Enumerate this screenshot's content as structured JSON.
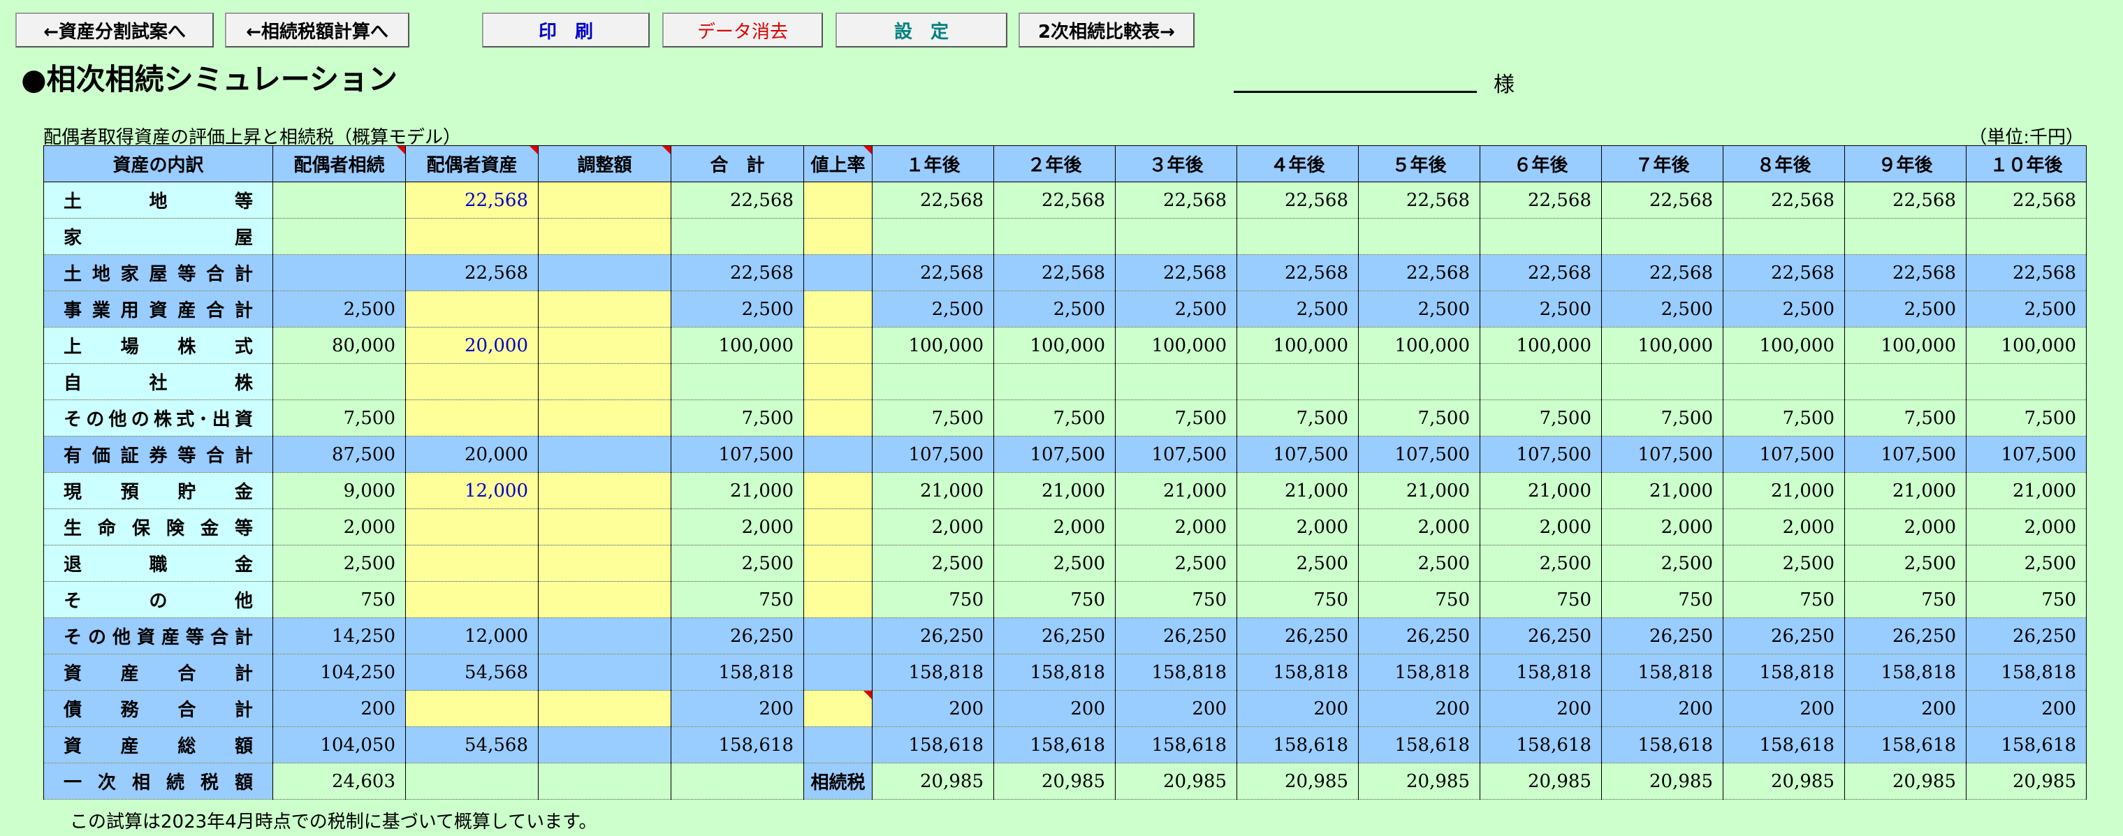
{
  "toolbar": {
    "buttons": [
      {
        "label": "←資産分割試案へ"
      },
      {
        "label": "←相続税額計算へ"
      },
      {
        "label": "印　刷"
      },
      {
        "label": "データ消去"
      },
      {
        "label": "設　定"
      },
      {
        "label": "2次相続比較表→"
      }
    ]
  },
  "colors": {
    "background": "#ccffcc",
    "header": "#99ccff",
    "input": "#ffff99",
    "detail_label": "#ccffff",
    "print_text": "#0000cc",
    "clear_text": "#e00000",
    "settings_text": "#008080"
  },
  "page": {
    "title": "●相次相続シミュレーション",
    "name_suffix": "様",
    "subtitle": "配偶者取得資産の評価上昇と相続税（概算モデル）",
    "unit": "（単位:千円）",
    "footnote": "この試算は2023年4月時点での税制に基づいて概算しています。"
  },
  "table": {
    "headers": [
      "資産の内訳",
      "配偶者相続",
      "配偶者資産",
      "調整額",
      "合　計",
      "値上率",
      "１年後",
      "２年後",
      "３年後",
      "４年後",
      "５年後",
      "６年後",
      "７年後",
      "８年後",
      "９年後",
      "１０年後"
    ],
    "rows": [
      {
        "label": "土地等",
        "type": "detail",
        "cells": [
          "",
          "22,568",
          "",
          "22,568",
          "",
          "22,568",
          "22,568",
          "22,568",
          "22,568",
          "22,568",
          "22,568",
          "22,568",
          "22,568",
          "22,568",
          "22,568"
        ]
      },
      {
        "label": "家屋",
        "type": "detail",
        "cells": [
          "",
          "",
          "",
          "",
          "",
          "",
          "",
          "",
          "",
          "",
          "",
          "",
          "",
          "",
          ""
        ]
      },
      {
        "label": "土地家屋等合計",
        "type": "total",
        "cells": [
          "",
          "22,568",
          "",
          "22,568",
          "",
          "22,568",
          "22,568",
          "22,568",
          "22,568",
          "22,568",
          "22,568",
          "22,568",
          "22,568",
          "22,568",
          "22,568"
        ]
      },
      {
        "label": "事業用資産合計",
        "type": "total",
        "cells": [
          "2,500",
          "",
          "",
          "2,500",
          "",
          "2,500",
          "2,500",
          "2,500",
          "2,500",
          "2,500",
          "2,500",
          "2,500",
          "2,500",
          "2,500",
          "2,500"
        ]
      },
      {
        "label": "上場株式",
        "type": "detail",
        "cells": [
          "80,000",
          "20,000",
          "",
          "100,000",
          "",
          "100,000",
          "100,000",
          "100,000",
          "100,000",
          "100,000",
          "100,000",
          "100,000",
          "100,000",
          "100,000",
          "100,000"
        ]
      },
      {
        "label": "自社株",
        "type": "detail",
        "cells": [
          "",
          "",
          "",
          "",
          "",
          "",
          "",
          "",
          "",
          "",
          "",
          "",
          "",
          "",
          ""
        ]
      },
      {
        "label": "その他の株式･出資",
        "type": "detail",
        "cells": [
          "7,500",
          "",
          "",
          "7,500",
          "",
          "7,500",
          "7,500",
          "7,500",
          "7,500",
          "7,500",
          "7,500",
          "7,500",
          "7,500",
          "7,500",
          "7,500"
        ]
      },
      {
        "label": "有価証券等合計",
        "type": "total",
        "cells": [
          "87,500",
          "20,000",
          "",
          "107,500",
          "",
          "107,500",
          "107,500",
          "107,500",
          "107,500",
          "107,500",
          "107,500",
          "107,500",
          "107,500",
          "107,500",
          "107,500"
        ]
      },
      {
        "label": "現預貯金",
        "type": "detail",
        "cells": [
          "9,000",
          "12,000",
          "",
          "21,000",
          "",
          "21,000",
          "21,000",
          "21,000",
          "21,000",
          "21,000",
          "21,000",
          "21,000",
          "21,000",
          "21,000",
          "21,000"
        ]
      },
      {
        "label": "生命保険金等",
        "type": "detail",
        "cells": [
          "2,000",
          "",
          "",
          "2,000",
          "",
          "2,000",
          "2,000",
          "2,000",
          "2,000",
          "2,000",
          "2,000",
          "2,000",
          "2,000",
          "2,000",
          "2,000"
        ]
      },
      {
        "label": "退職金",
        "type": "detail",
        "cells": [
          "2,500",
          "",
          "",
          "2,500",
          "",
          "2,500",
          "2,500",
          "2,500",
          "2,500",
          "2,500",
          "2,500",
          "2,500",
          "2,500",
          "2,500",
          "2,500"
        ]
      },
      {
        "label": "その他",
        "type": "detail",
        "cells": [
          "750",
          "",
          "",
          "750",
          "",
          "750",
          "750",
          "750",
          "750",
          "750",
          "750",
          "750",
          "750",
          "750",
          "750"
        ]
      },
      {
        "label": "その他資産等合計",
        "type": "total",
        "cells": [
          "14,250",
          "12,000",
          "",
          "26,250",
          "",
          "26,250",
          "26,250",
          "26,250",
          "26,250",
          "26,250",
          "26,250",
          "26,250",
          "26,250",
          "26,250",
          "26,250"
        ]
      },
      {
        "label": "資産合計",
        "type": "total",
        "cells": [
          "104,250",
          "54,568",
          "",
          "158,818",
          "",
          "158,818",
          "158,818",
          "158,818",
          "158,818",
          "158,818",
          "158,818",
          "158,818",
          "158,818",
          "158,818",
          "158,818"
        ]
      },
      {
        "label": "債務合計",
        "type": "total",
        "cells": [
          "200",
          "",
          "",
          "200",
          "",
          "200",
          "200",
          "200",
          "200",
          "200",
          "200",
          "200",
          "200",
          "200",
          "200"
        ]
      },
      {
        "label": "資産総額",
        "type": "total",
        "cells": [
          "104,050",
          "54,568",
          "",
          "158,618",
          "",
          "158,618",
          "158,618",
          "158,618",
          "158,618",
          "158,618",
          "158,618",
          "158,618",
          "158,618",
          "158,618",
          "158,618"
        ]
      },
      {
        "label": "一次相続税額",
        "type": "tax",
        "cells": [
          "24,603",
          "",
          "",
          "",
          "相続税",
          "20,985",
          "20,985",
          "20,985",
          "20,985",
          "20,985",
          "20,985",
          "20,985",
          "20,985",
          "20,985",
          "20,985"
        ]
      }
    ]
  }
}
